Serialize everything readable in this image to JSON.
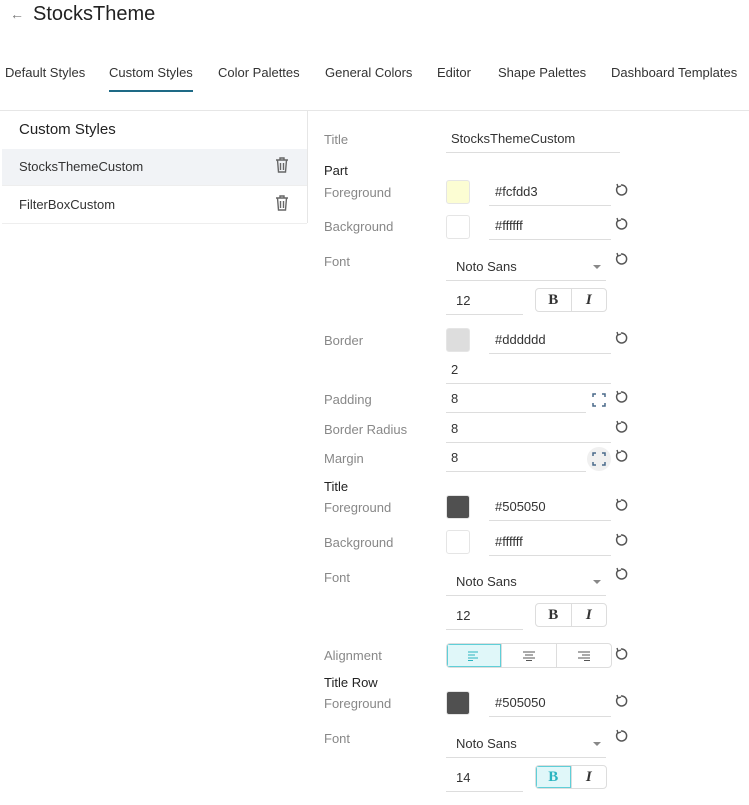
{
  "header": {
    "title": "StocksTheme"
  },
  "tabs": [
    {
      "label": "Default Styles"
    },
    {
      "label": "Custom Styles",
      "active": true
    },
    {
      "label": "Color Palettes"
    },
    {
      "label": "General Colors"
    },
    {
      "label": "Editor"
    },
    {
      "label": "Shape Palettes"
    },
    {
      "label": "Dashboard Templates"
    }
  ],
  "left_panel": {
    "heading": "Custom Styles",
    "items": [
      {
        "label": "StocksThemeCustom",
        "selected": true
      },
      {
        "label": "FilterBoxCustom"
      }
    ]
  },
  "form": {
    "title_label": "Title",
    "title_value": "StocksThemeCustom",
    "part": {
      "heading": "Part",
      "foreground_label": "Foreground",
      "foreground": "#fcfdd3",
      "background_label": "Background",
      "background": "#ffffff",
      "font_label": "Font",
      "font": "Noto Sans",
      "size": "12",
      "bold": "B",
      "italic": "I",
      "border_label": "Border",
      "border_color": "#dddddd",
      "border_width": "2",
      "padding_label": "Padding",
      "padding": "8",
      "radius_label": "Border Radius",
      "radius": "8",
      "margin_label": "Margin",
      "margin": "8"
    },
    "title": {
      "heading": "Title",
      "foreground_label": "Foreground",
      "foreground": "#505050",
      "background_label": "Background",
      "background": "#ffffff",
      "font_label": "Font",
      "font": "Noto Sans",
      "size": "12",
      "bold": "B",
      "italic": "I",
      "alignment_label": "Alignment",
      "alignment": "left"
    },
    "title_row": {
      "heading": "Title Row",
      "foreground_label": "Foreground",
      "foreground": "#505050",
      "font_label": "Font",
      "font": "Noto Sans",
      "size": "14",
      "bold": "B",
      "italic": "I",
      "bold_active": true
    }
  }
}
